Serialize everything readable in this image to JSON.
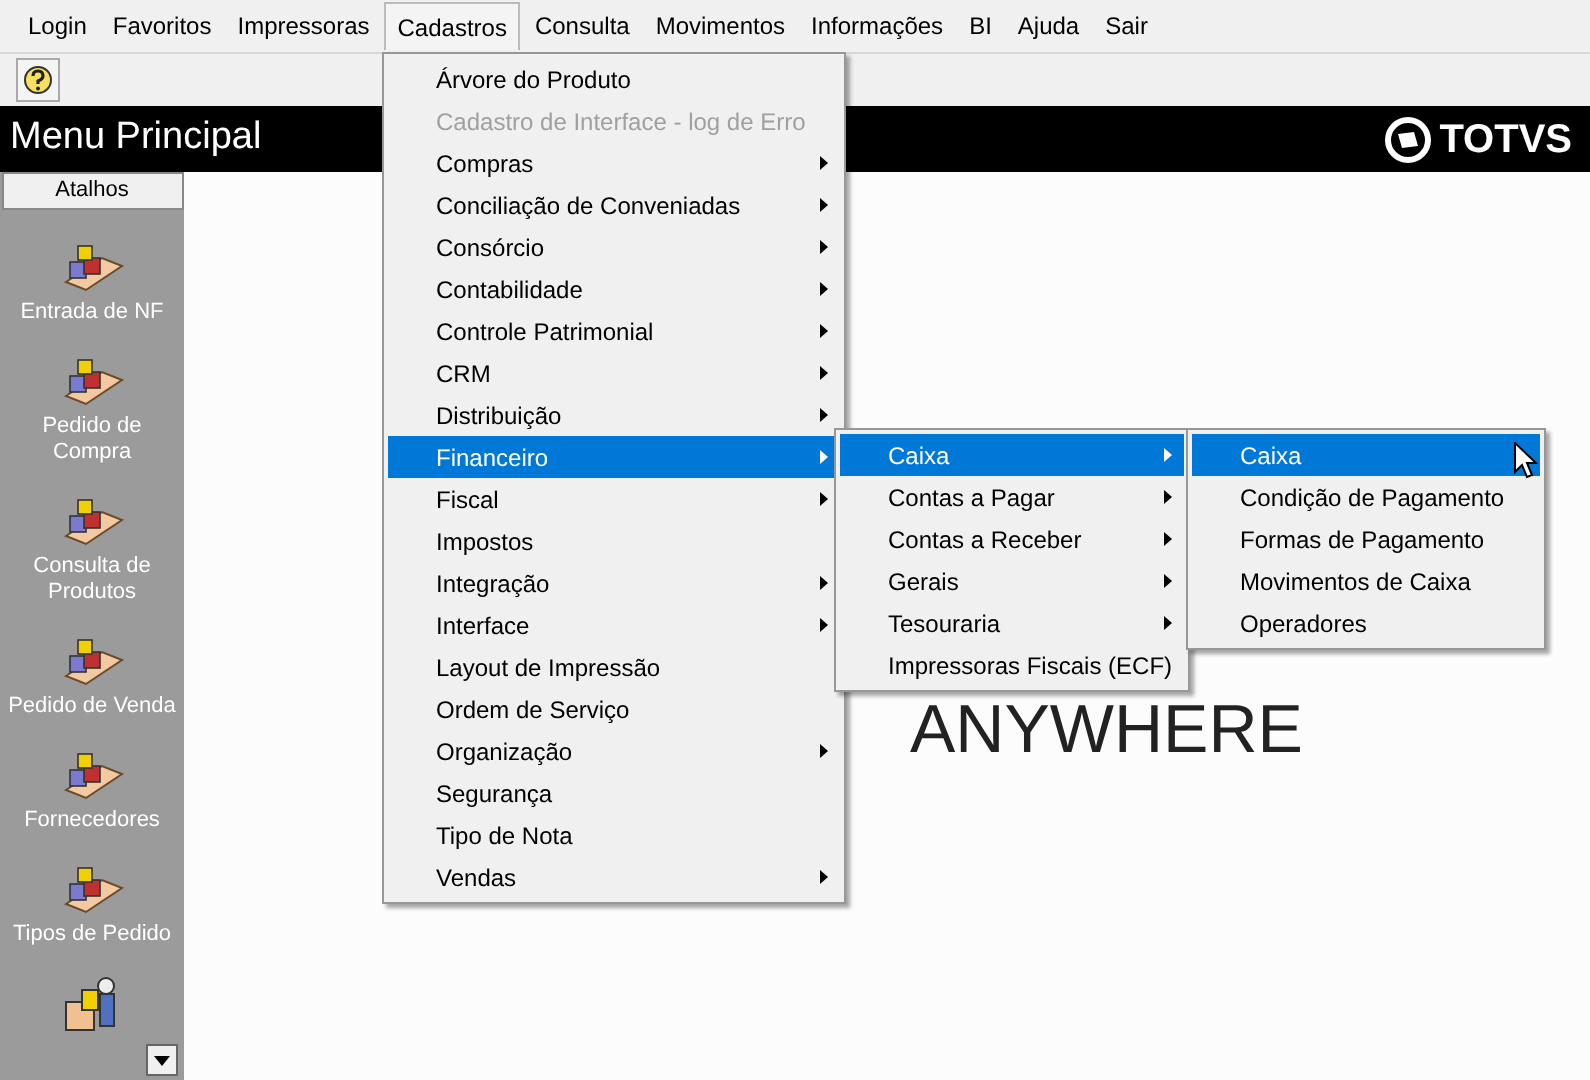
{
  "menu_bar": [
    {
      "label": "Login",
      "selected": false
    },
    {
      "label": "Favoritos",
      "selected": false
    },
    {
      "label": "Impressoras",
      "selected": false
    },
    {
      "label": "Cadastros",
      "selected": true
    },
    {
      "label": "Consulta",
      "selected": false
    },
    {
      "label": "Movimentos",
      "selected": false
    },
    {
      "label": "Informações",
      "selected": false
    },
    {
      "label": "BI",
      "selected": false
    },
    {
      "label": "Ajuda",
      "selected": false
    },
    {
      "label": "Sair",
      "selected": false
    }
  ],
  "banner": {
    "title": "Menu Principal",
    "logo": "TOTVS"
  },
  "sidebar": {
    "header": "Atalhos",
    "items": [
      {
        "label": "Entrada de NF"
      },
      {
        "label": "Pedido de Compra"
      },
      {
        "label": "Consulta de Produtos"
      },
      {
        "label": "Pedido de Venda"
      },
      {
        "label": "Fornecedores"
      },
      {
        "label": "Tipos de Pedido"
      }
    ]
  },
  "background_text": "ANYWHERE",
  "menus": [
    {
      "items": [
        {
          "label": "Árvore do Produto",
          "submenu": false,
          "disabled": false,
          "selected": false
        },
        {
          "label": "Cadastro de Interface - log de Erro",
          "submenu": false,
          "disabled": true,
          "selected": false
        },
        {
          "label": "Compras",
          "submenu": true,
          "disabled": false,
          "selected": false
        },
        {
          "label": "Conciliação de Conveniadas",
          "submenu": true,
          "disabled": false,
          "selected": false
        },
        {
          "label": "Consórcio",
          "submenu": true,
          "disabled": false,
          "selected": false
        },
        {
          "label": "Contabilidade",
          "submenu": true,
          "disabled": false,
          "selected": false
        },
        {
          "label": "Controle Patrimonial",
          "submenu": true,
          "disabled": false,
          "selected": false
        },
        {
          "label": "CRM",
          "submenu": true,
          "disabled": false,
          "selected": false
        },
        {
          "label": "Distribuição",
          "submenu": true,
          "disabled": false,
          "selected": false
        },
        {
          "label": "Financeiro",
          "submenu": true,
          "disabled": false,
          "selected": true
        },
        {
          "label": "Fiscal",
          "submenu": true,
          "disabled": false,
          "selected": false
        },
        {
          "label": "Impostos",
          "submenu": false,
          "disabled": false,
          "selected": false
        },
        {
          "label": "Integração",
          "submenu": true,
          "disabled": false,
          "selected": false
        },
        {
          "label": "Interface",
          "submenu": true,
          "disabled": false,
          "selected": false
        },
        {
          "label": "Layout de Impressão",
          "submenu": false,
          "disabled": false,
          "selected": false
        },
        {
          "label": "Ordem de Serviço",
          "submenu": false,
          "disabled": false,
          "selected": false
        },
        {
          "label": "Organização",
          "submenu": true,
          "disabled": false,
          "selected": false
        },
        {
          "label": "Segurança",
          "submenu": false,
          "disabled": false,
          "selected": false
        },
        {
          "label": "Tipo de Nota",
          "submenu": false,
          "disabled": false,
          "selected": false
        },
        {
          "label": "Vendas",
          "submenu": true,
          "disabled": false,
          "selected": false
        }
      ]
    },
    {
      "items": [
        {
          "label": "Caixa",
          "submenu": true,
          "disabled": false,
          "selected": true
        },
        {
          "label": "Contas a Pagar",
          "submenu": true,
          "disabled": false,
          "selected": false
        },
        {
          "label": "Contas a Receber",
          "submenu": true,
          "disabled": false,
          "selected": false
        },
        {
          "label": "Gerais",
          "submenu": true,
          "disabled": false,
          "selected": false
        },
        {
          "label": "Tesouraria",
          "submenu": true,
          "disabled": false,
          "selected": false
        },
        {
          "label": "Impressoras Fiscais (ECF)",
          "submenu": false,
          "disabled": false,
          "selected": false
        }
      ]
    },
    {
      "items": [
        {
          "label": "Caixa",
          "submenu": false,
          "disabled": false,
          "selected": true
        },
        {
          "label": "Condição de Pagamento",
          "submenu": false,
          "disabled": false,
          "selected": false
        },
        {
          "label": "Formas de Pagamento",
          "submenu": false,
          "disabled": false,
          "selected": false
        },
        {
          "label": "Movimentos de Caixa",
          "submenu": false,
          "disabled": false,
          "selected": false
        },
        {
          "label": "Operadores",
          "submenu": false,
          "disabled": false,
          "selected": false
        }
      ]
    }
  ]
}
